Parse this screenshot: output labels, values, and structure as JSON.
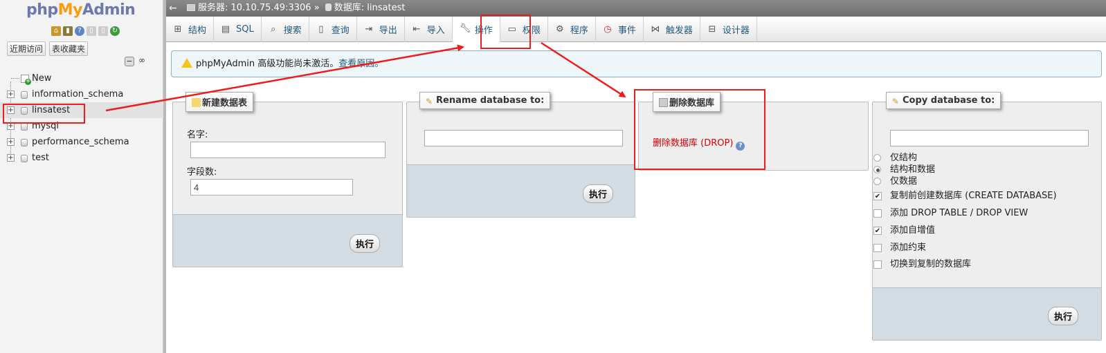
{
  "sidebar": {
    "logo": {
      "php": "php",
      "my": "My",
      "admin": "Admin"
    },
    "buttons": {
      "recent": "近期访问",
      "favorites": "表收藏夹"
    },
    "tree": [
      {
        "label": "New"
      },
      {
        "label": "information_schema"
      },
      {
        "label": "linsatest"
      },
      {
        "label": "mysql"
      },
      {
        "label": "performance_schema"
      },
      {
        "label": "test"
      }
    ]
  },
  "topbar": {
    "server": "服务器: 10.10.75.49:3306",
    "sep": "»",
    "database": "数据库: linsatest"
  },
  "tabs": [
    {
      "label": "结构",
      "icon": "structure-icon"
    },
    {
      "label": "SQL",
      "icon": "sql-icon"
    },
    {
      "label": "搜索",
      "icon": "search-icon"
    },
    {
      "label": "查询",
      "icon": "query-icon"
    },
    {
      "label": "导出",
      "icon": "export-icon"
    },
    {
      "label": "导入",
      "icon": "import-icon"
    },
    {
      "label": "操作",
      "icon": "wrench-icon"
    },
    {
      "label": "权限",
      "icon": "privileges-icon"
    },
    {
      "label": "程序",
      "icon": "routines-icon"
    },
    {
      "label": "事件",
      "icon": "events-icon"
    },
    {
      "label": "触发器",
      "icon": "triggers-icon"
    },
    {
      "label": "设计器",
      "icon": "designer-icon"
    }
  ],
  "notice": {
    "text": "phpMyAdmin 高级功能尚未激活。",
    "link": "查看原因。"
  },
  "create_table": {
    "legend": "新建数据表",
    "name_label": "名字:",
    "name_value": "",
    "fields_label": "字段数:",
    "fields_value": "4",
    "go": "执行"
  },
  "rename_db": {
    "legend": "Rename database to:",
    "value": "",
    "go": "执行"
  },
  "drop_db": {
    "legend": "删除数据库",
    "link": "删除数据库 (DROP)"
  },
  "copy_db": {
    "legend": "Copy database to:",
    "value": "",
    "radios": [
      {
        "label": "仅结构",
        "checked": false
      },
      {
        "label": "结构和数据",
        "checked": true
      },
      {
        "label": "仅数据",
        "checked": false
      }
    ],
    "checks": [
      {
        "label": "复制前创建数据库 (CREATE DATABASE)",
        "checked": true
      },
      {
        "label": "添加 DROP TABLE / DROP VIEW",
        "checked": false
      },
      {
        "label": "添加自增值",
        "checked": true
      },
      {
        "label": "添加约束",
        "checked": false
      },
      {
        "label": "切换到复制的数据库",
        "checked": false
      }
    ],
    "go": "执行"
  },
  "colors": {
    "annotation": "#ee1c1c",
    "link": "#235a81",
    "drop": "#dd0000"
  }
}
